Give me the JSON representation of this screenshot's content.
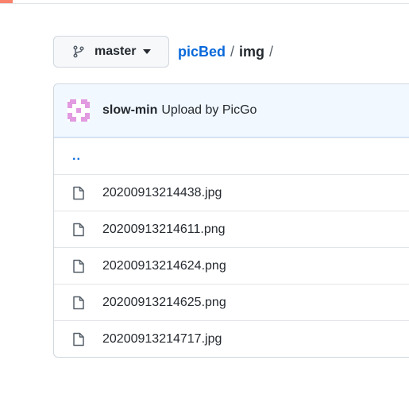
{
  "branch": {
    "label": "master",
    "icon": "git-branch-icon"
  },
  "breadcrumb": {
    "repo": "picBed",
    "folder": "img",
    "separator": "/"
  },
  "commit": {
    "author": "slow-min",
    "message": "Upload by PicGo",
    "avatar_color": "#e29ae0"
  },
  "files": {
    "parent": "..",
    "items": [
      {
        "name": "20200913214438.jpg",
        "icon": "file-icon"
      },
      {
        "name": "20200913214611.png",
        "icon": "file-icon"
      },
      {
        "name": "20200913214624.png",
        "icon": "file-icon"
      },
      {
        "name": "20200913214625.png",
        "icon": "file-icon"
      },
      {
        "name": "20200913214717.jpg",
        "icon": "file-icon"
      }
    ]
  },
  "colors": {
    "link": "#0969da",
    "commit_bar_bg": "#f1f8ff",
    "accent": "#f9826c"
  }
}
